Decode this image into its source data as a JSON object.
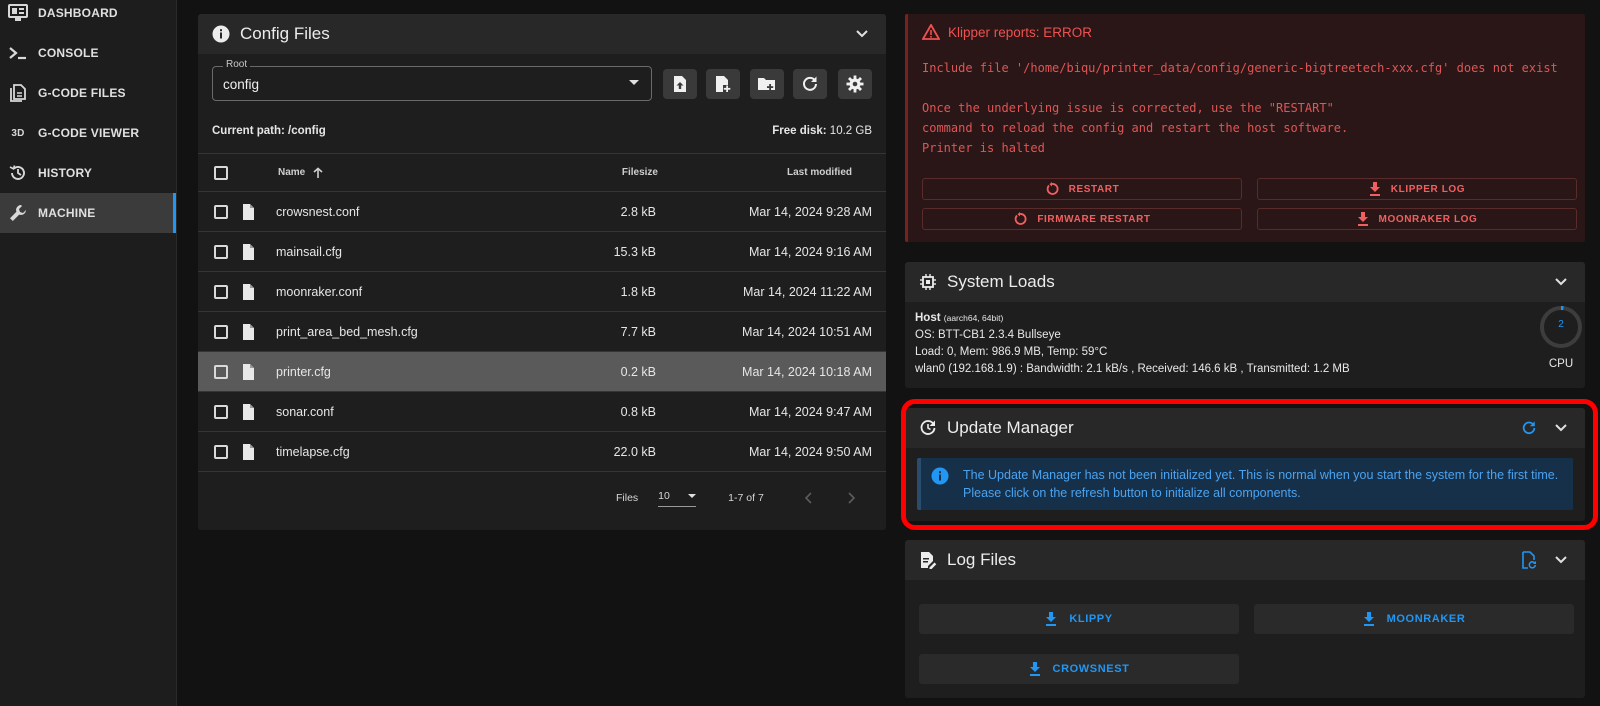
{
  "sidebar": {
    "items": [
      {
        "label": "DASHBOARD",
        "icon": "monitor-dashboard-icon"
      },
      {
        "label": "CONSOLE",
        "icon": "console-prompt-icon"
      },
      {
        "label": "G-CODE FILES",
        "icon": "file-document-multiple-icon"
      },
      {
        "label": "G-CODE VIEWER",
        "icon": "3d-icon",
        "glyph": "3D"
      },
      {
        "label": "HISTORY",
        "icon": "history-icon"
      },
      {
        "label": "MACHINE",
        "icon": "wrench-icon",
        "active": true
      }
    ]
  },
  "config_files": {
    "title": "Config Files",
    "root_label": "Root",
    "root_value": "config",
    "current_path_label": "Current path:",
    "current_path": "/config",
    "free_disk_label": "Free disk:",
    "free_disk": "10.2 GB",
    "headers": {
      "name": "Name",
      "filesize": "Filesize",
      "modified": "Last modified"
    },
    "files": [
      {
        "name": "crowsnest.conf",
        "size": "2.8 kB",
        "modified": "Mar 14, 2024 9:28 AM"
      },
      {
        "name": "mainsail.cfg",
        "size": "15.3 kB",
        "modified": "Mar 14, 2024 9:16 AM"
      },
      {
        "name": "moonraker.conf",
        "size": "1.8 kB",
        "modified": "Mar 14, 2024 11:22 AM"
      },
      {
        "name": "print_area_bed_mesh.cfg",
        "size": "7.7 kB",
        "modified": "Mar 14, 2024 10:51 AM"
      },
      {
        "name": "printer.cfg",
        "size": "0.2 kB",
        "modified": "Mar 14, 2024 10:18 AM",
        "selected": true
      },
      {
        "name": "sonar.conf",
        "size": "0.8 kB",
        "modified": "Mar 14, 2024 9:47 AM"
      },
      {
        "name": "timelapse.cfg",
        "size": "22.0 kB",
        "modified": "Mar 14, 2024 9:50 AM"
      }
    ],
    "footer": {
      "files_label": "Files",
      "per_page": "10",
      "range": "1-7 of 7"
    }
  },
  "error": {
    "title": "Klipper reports: ERROR",
    "message": "Include file '/home/biqu/printer_data/config/generic-bigtreetech-xxx.cfg' does not exist\n\nOnce the underlying issue is corrected, use the \"RESTART\"\ncommand to reload the config and restart the host software.\nPrinter is halted",
    "buttons": {
      "restart": "RESTART",
      "klipper_log": "KLIPPER LOG",
      "firmware_restart": "FIRMWARE RESTART",
      "moonraker_log": "MOONRAKER LOG"
    },
    "color": "#f05050"
  },
  "system_loads": {
    "title": "System Loads",
    "host_label": "Host",
    "host_arch": "(aarch64, 64bit)",
    "os": "OS: BTT-CB1 2.3.4 Bullseye",
    "load": "Load: 0, Mem: 986.9 MB, Temp: 59°C",
    "network": "wlan0 (192.168.1.9) : Bandwidth: 2.1 kB/s , Received: 146.6 kB , Transmitted: 1.2 MB",
    "cpu_value": "2",
    "cpu_label": "CPU"
  },
  "update_manager": {
    "title": "Update Manager",
    "info": "The Update Manager has not been initialized yet. This is normal when you start the system for the first time. Please click on the refresh button to initialize all components."
  },
  "log_files": {
    "title": "Log Files",
    "buttons": {
      "klippy": "KLIPPY",
      "moonraker": "MOONRAKER",
      "crowsnest": "CROWSNEST"
    }
  },
  "colors": {
    "accent": "#2196f3",
    "error": "#f05050",
    "highlight": "#ff0000"
  }
}
